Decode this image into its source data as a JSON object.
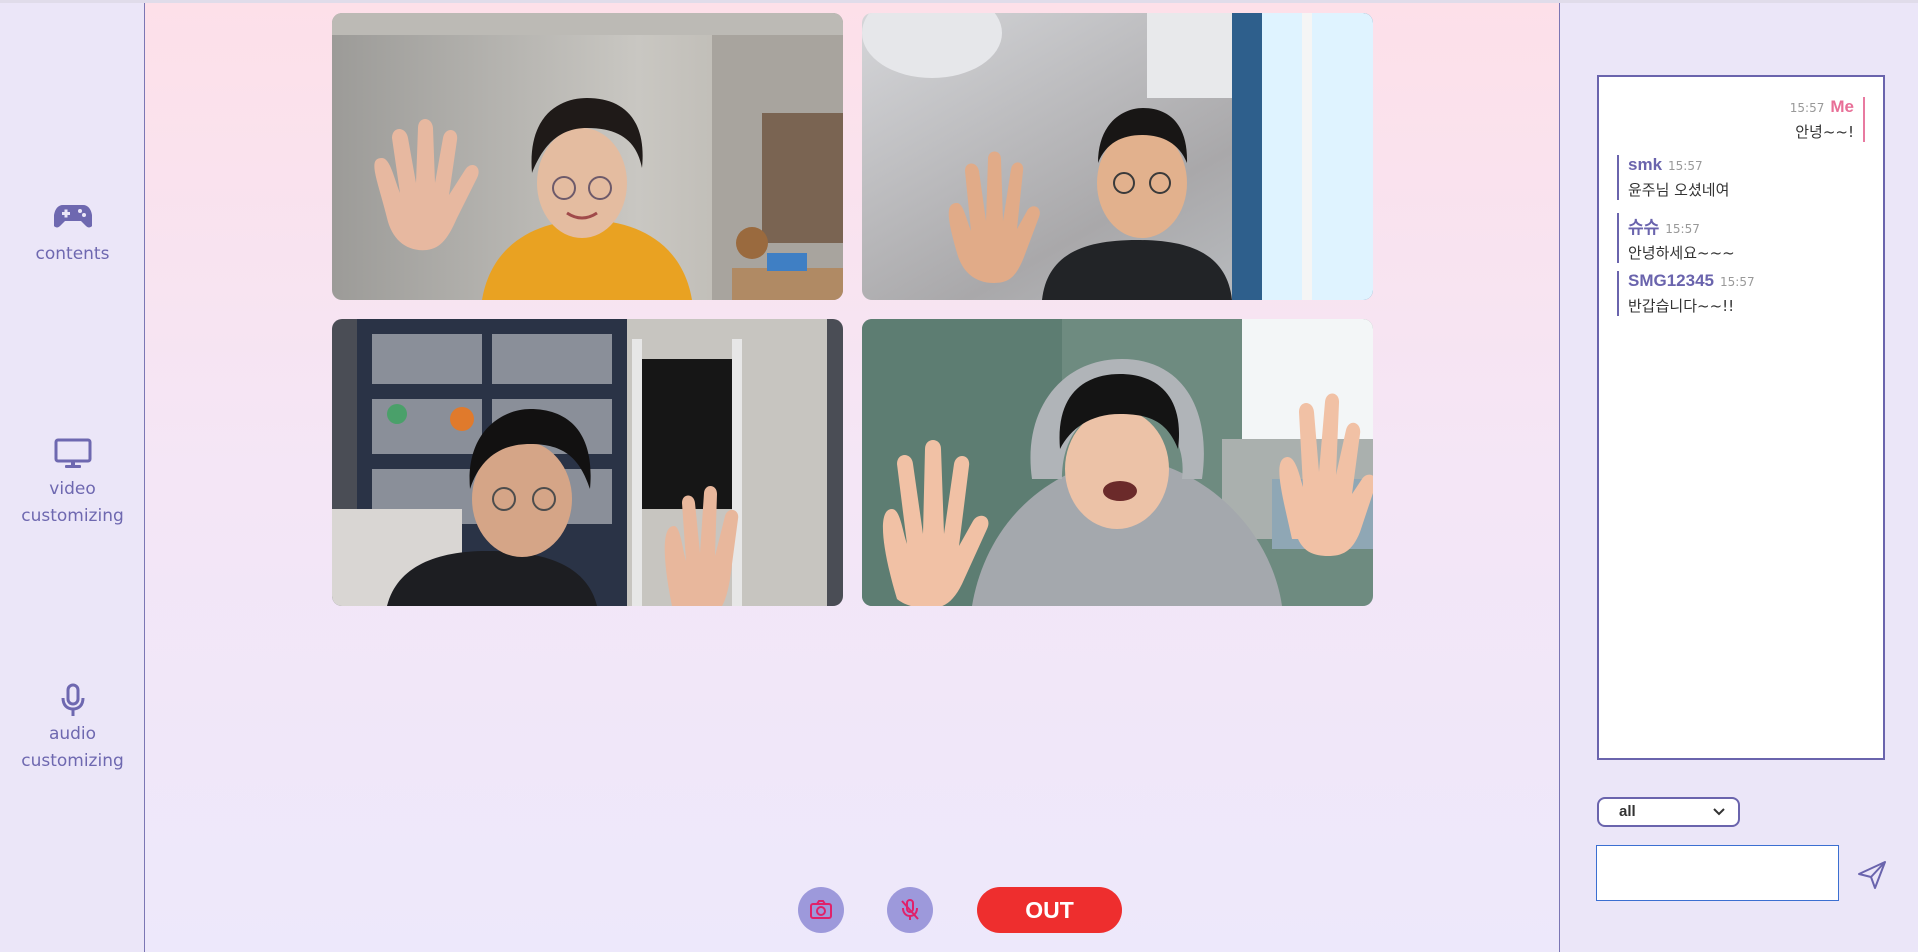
{
  "sidebar": {
    "items": [
      {
        "label": "contents",
        "icon": "gamepad-icon"
      },
      {
        "label": "video\ncustomizing",
        "label_lines": [
          "video",
          "customizing"
        ],
        "icon": "monitor-icon"
      },
      {
        "label": "audio\ncustomizing",
        "label_lines": [
          "audio",
          "customizing"
        ],
        "icon": "microphone-icon"
      }
    ]
  },
  "stage": {
    "participants": [
      {
        "tile": "top-left",
        "description_icon": "video-feed"
      },
      {
        "tile": "top-right",
        "description_icon": "video-feed"
      },
      {
        "tile": "bottom-left",
        "description_icon": "video-feed"
      },
      {
        "tile": "bottom-right",
        "description_icon": "video-feed"
      }
    ],
    "controls": {
      "camera_icon": "camera-icon",
      "mic_icon": "microphone-off-icon",
      "out_label": "OUT"
    }
  },
  "chat": {
    "messages": [
      {
        "sender": "Me",
        "time": "15:57",
        "text": "안녕~~!",
        "self": true
      },
      {
        "sender": "smk",
        "time": "15:57",
        "text": "윤주님 오셨네여",
        "self": false
      },
      {
        "sender": "슈슈",
        "time": "15:57",
        "text": "안녕하세요~~~",
        "self": false
      },
      {
        "sender": "SMG12345",
        "time": "15:57",
        "text": "반갑습니다~~!!",
        "self": false
      }
    ],
    "recipient_select": {
      "selected": "all"
    },
    "input": {
      "value": "",
      "placeholder": ""
    },
    "send_icon": "send-icon"
  },
  "colors": {
    "accent": "#6a64ad",
    "self_accent": "#e86f97",
    "out_button": "#ee2e2e",
    "control_button": "#9d99db"
  }
}
